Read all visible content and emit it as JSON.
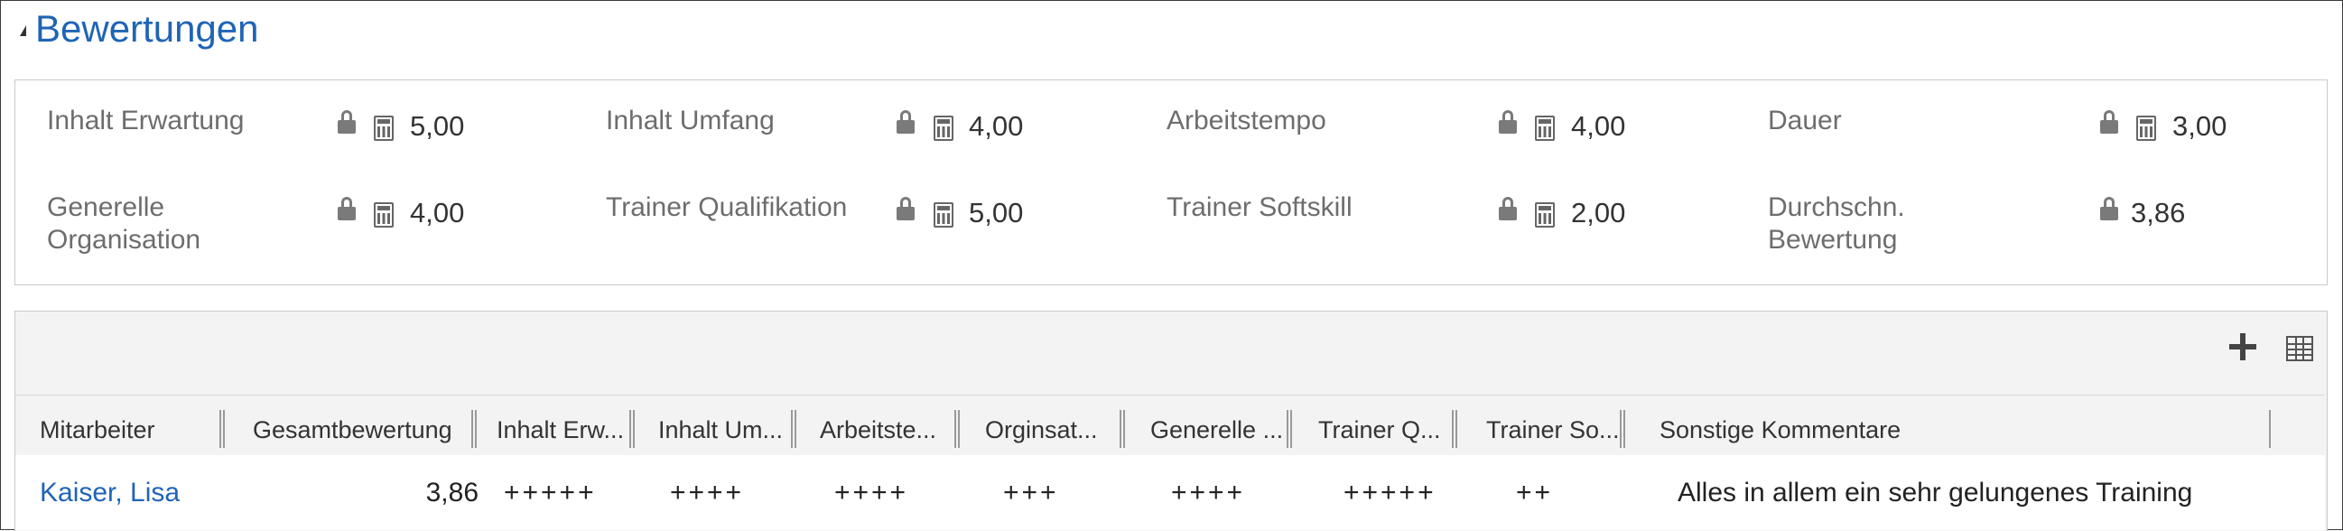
{
  "section": {
    "title": "Bewertungen"
  },
  "fields": [
    {
      "label": "Inhalt Erwartung",
      "value": "5,00",
      "calc": true
    },
    {
      "label": "Inhalt Umfang",
      "value": "4,00",
      "calc": true
    },
    {
      "label": "Arbeitstempo",
      "value": "4,00",
      "calc": true
    },
    {
      "label": "Dauer",
      "value": "3,00",
      "calc": true
    },
    {
      "label_line1": "Generelle",
      "label_line2": "Organisation",
      "value": "4,00",
      "calc": true
    },
    {
      "label": "Trainer Qualifikation",
      "value": "5,00",
      "calc": true
    },
    {
      "label": "Trainer Softskill",
      "value": "2,00",
      "calc": true
    },
    {
      "label_line1": "Durchschn.",
      "label_line2": "Bewertung",
      "value": "3,86",
      "calc": false
    }
  ],
  "grid": {
    "toolbar": {
      "add_icon": "plus-icon",
      "view_icon": "grid-view-icon"
    },
    "columns": [
      "Mitarbeiter",
      "Gesamtbewertung",
      "Inhalt Erw...",
      "Inhalt Um...",
      "Arbeitste...",
      "Orginsat...",
      "Generelle ...",
      "Trainer Q...",
      "Trainer So...",
      "Sonstige Kommentare"
    ],
    "rows": [
      {
        "mitarbeiter": "Kaiser, Lisa",
        "gesamt": "3,86",
        "inhalt_erw": "+++++",
        "inhalt_um": "++++",
        "arbeitstempo": "++++",
        "organisation": "+++",
        "generelle": "++++",
        "trainer_q": "+++++",
        "trainer_so": "++",
        "kommentar": "Alles in allem ein sehr gelungenes Training"
      }
    ]
  }
}
